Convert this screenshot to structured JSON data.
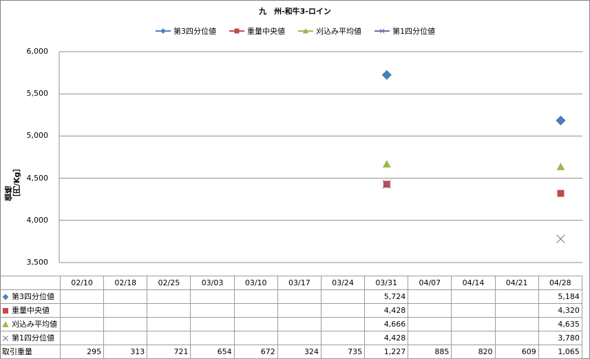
{
  "chart_data": {
    "type": "scatter",
    "title": "九　州-和牛3-ロイン",
    "ylabel": "価格［円/Kg］",
    "xlabel": "",
    "ylim": [
      3500,
      6000
    ],
    "yticks": [
      "3,500",
      "4,000",
      "4,500",
      "5,000",
      "5,500",
      "6,000"
    ],
    "ytick_values": [
      3500,
      4000,
      4500,
      5000,
      5500,
      6000
    ],
    "grid": true,
    "legend_position": "top",
    "categories": [
      "02/10",
      "02/18",
      "02/25",
      "03/03",
      "03/10",
      "03/17",
      "03/24",
      "03/31",
      "04/07",
      "04/14",
      "04/21",
      "04/28"
    ],
    "series": [
      {
        "name": "第3四分位値",
        "marker": "diamond",
        "color": "#4a7ebb",
        "values": [
          null,
          null,
          null,
          null,
          null,
          null,
          null,
          5724,
          null,
          null,
          null,
          5184
        ],
        "labels": [
          "",
          "",
          "",
          "",
          "",
          "",
          "",
          "5,724",
          "",
          "",
          "",
          "5,184"
        ]
      },
      {
        "name": "重量中央値",
        "marker": "square",
        "color": "#be4b48",
        "values": [
          null,
          null,
          null,
          null,
          null,
          null,
          null,
          4428,
          null,
          null,
          null,
          4320
        ],
        "labels": [
          "",
          "",
          "",
          "",
          "",
          "",
          "",
          "4,428",
          "",
          "",
          "",
          "4,320"
        ]
      },
      {
        "name": "刈込み平均値",
        "marker": "triangle",
        "color": "#98b954",
        "values": [
          null,
          null,
          null,
          null,
          null,
          null,
          null,
          4666,
          null,
          null,
          null,
          4635
        ],
        "labels": [
          "",
          "",
          "",
          "",
          "",
          "",
          "",
          "4,666",
          "",
          "",
          "",
          "4,635"
        ]
      },
      {
        "name": "第1四分位値",
        "marker": "x",
        "color": "#7d60a0",
        "values": [
          null,
          null,
          null,
          null,
          null,
          null,
          null,
          4428,
          null,
          null,
          null,
          3780
        ],
        "labels": [
          "",
          "",
          "",
          "",
          "",
          "",
          "",
          "4,428",
          "",
          "",
          "",
          "3,780"
        ]
      }
    ],
    "table_extra_row": {
      "name": "取引重量",
      "values": [
        "295",
        "313",
        "721",
        "654",
        "672",
        "324",
        "735",
        "1,227",
        "885",
        "820",
        "609",
        "1,065"
      ]
    }
  }
}
